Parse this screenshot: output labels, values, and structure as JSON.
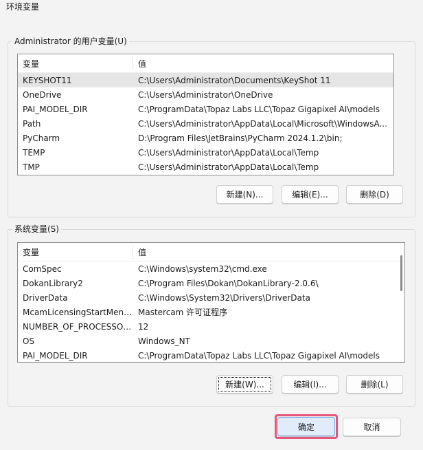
{
  "window": {
    "title": "环境变量"
  },
  "user_vars": {
    "legend": "Administrator 的用户变量(U)",
    "col_name": "变量",
    "col_value": "值",
    "rows": [
      {
        "name": "KEYSHOT11",
        "value": "C:\\Users\\Administrator\\Documents\\KeyShot 11"
      },
      {
        "name": "OneDrive",
        "value": "C:\\Users\\Administrator\\OneDrive"
      },
      {
        "name": "PAI_MODEL_DIR",
        "value": "C:\\ProgramData\\Topaz Labs LLC\\Topaz Gigapixel AI\\models"
      },
      {
        "name": "Path",
        "value": "C:\\Users\\Administrator\\AppData\\Local\\Microsoft\\WindowsA..."
      },
      {
        "name": "PyCharm",
        "value": "D:\\Program Files\\JetBrains\\PyCharm 2024.1.2\\bin;"
      },
      {
        "name": "TEMP",
        "value": "C:\\Users\\Administrator\\AppData\\Local\\Temp"
      },
      {
        "name": "TMP",
        "value": "C:\\Users\\Administrator\\AppData\\Local\\Temp"
      }
    ],
    "buttons": {
      "new": "新建(N)...",
      "edit": "编辑(E)...",
      "delete": "删除(D)"
    }
  },
  "system_vars": {
    "legend": "系统变量(S)",
    "col_name": "变量",
    "col_value": "值",
    "rows": [
      {
        "name": "ComSpec",
        "value": "C:\\Windows\\system32\\cmd.exe"
      },
      {
        "name": "DokanLibrary2",
        "value": "C:\\Program Files\\Dokan\\DokanLibrary-2.0.6\\"
      },
      {
        "name": "DriverData",
        "value": "C:\\Windows\\System32\\Drivers\\DriverData"
      },
      {
        "name": "McamLicensingStartMenu...",
        "value": "Mastercam 许可证程序"
      },
      {
        "name": "NUMBER_OF_PROCESSORS",
        "value": "12"
      },
      {
        "name": "OS",
        "value": "Windows_NT"
      },
      {
        "name": "PAI_MODEL_DIR",
        "value": "C:\\ProgramData\\Topaz Labs LLC\\Topaz Gigapixel AI\\models"
      }
    ],
    "buttons": {
      "new": "新建(W)...",
      "edit": "编辑(I)...",
      "delete": "删除(L)"
    }
  },
  "footer": {
    "ok": "确定",
    "cancel": "取消"
  },
  "colors": {
    "highlight": "#e4567a",
    "selected_row": "#e5e5e5"
  }
}
